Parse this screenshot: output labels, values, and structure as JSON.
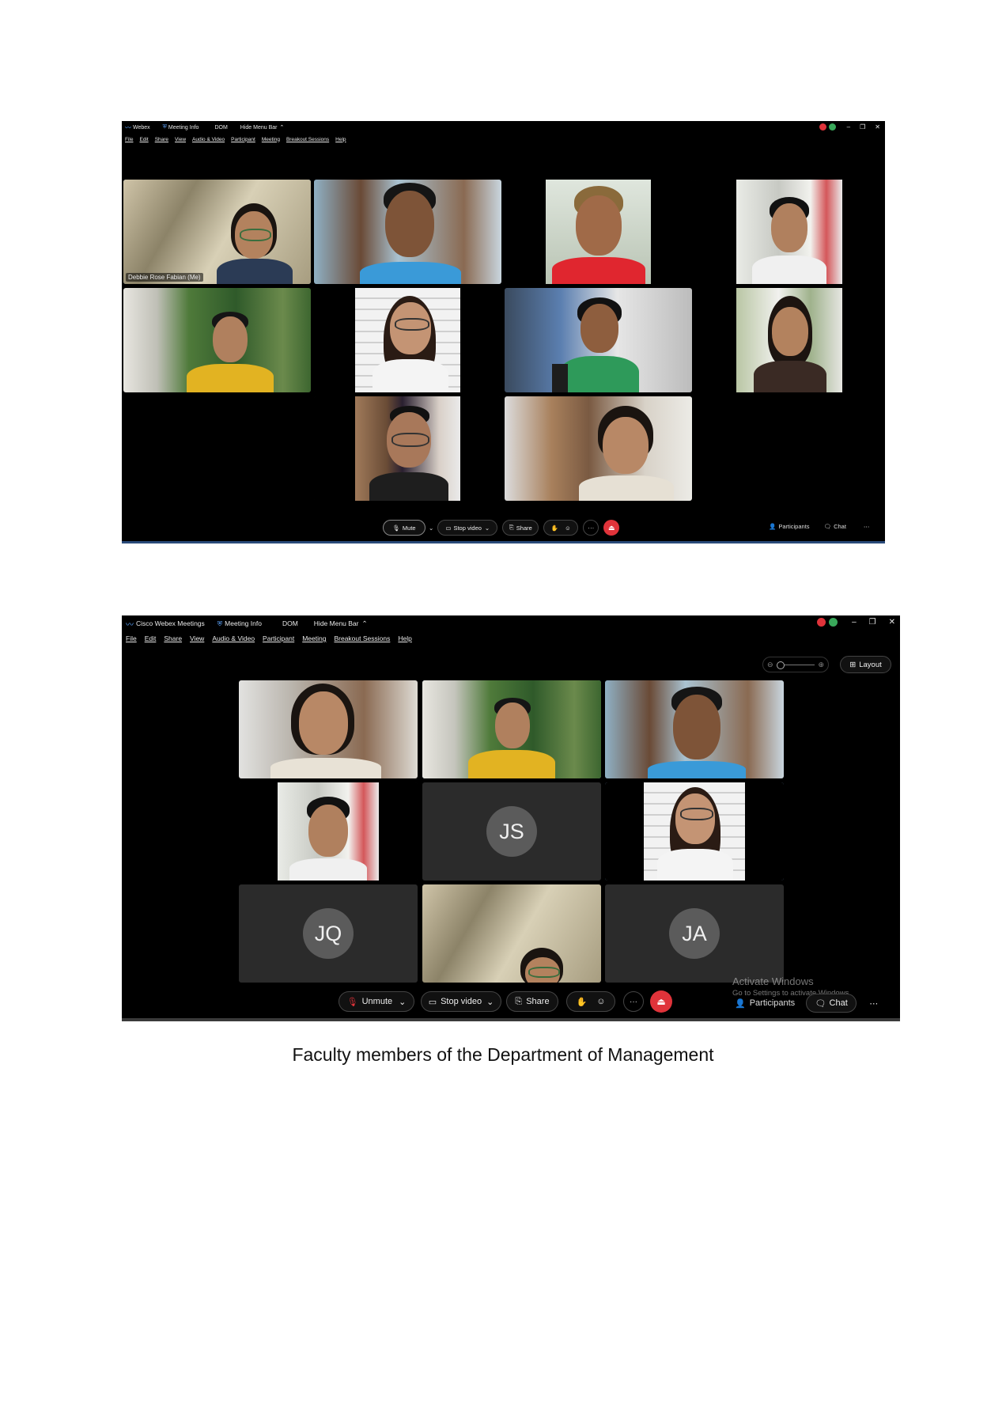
{
  "screen1": {
    "titlebar": {
      "app": "Webex",
      "meeting_info": "Meeting Info",
      "dom": "DOM",
      "hide_menu": "Hide Menu Bar"
    },
    "menu": [
      "File",
      "Edit",
      "Share",
      "View",
      "Audio & Video",
      "Participant",
      "Meeting",
      "Breakout Sessions",
      "Help"
    ],
    "self_name": "Debbie Rose Fabian (Me)",
    "controls": {
      "mute": "Mute",
      "stop_video": "Stop video",
      "share": "Share",
      "more": "···",
      "participants": "Participants",
      "chat": "Chat"
    }
  },
  "screen2": {
    "titlebar": {
      "app": "Cisco Webex Meetings",
      "meeting_info": "Meeting Info",
      "dom": "DOM",
      "hide_menu": "Hide Menu Bar"
    },
    "menu": [
      "File",
      "Edit",
      "Share",
      "View",
      "Audio & Video",
      "Participant",
      "Meeting",
      "Breakout Sessions",
      "Help"
    ],
    "layout_button": "Layout",
    "avatars": {
      "js": "JS",
      "jq": "JQ",
      "ja": "JA"
    },
    "controls": {
      "unmute": "Unmute",
      "stop_video": "Stop video",
      "share": "Share",
      "more": "···",
      "participants": "Participants",
      "chat": "Chat"
    },
    "watermark": {
      "line1": "Activate Windows",
      "line2": "Go to Settings to activate Windows."
    }
  },
  "caption": "Faculty members of the Department of Management",
  "colors": {
    "end_call": "#e0333a",
    "active_border": "#8fb8e8",
    "avatar_bg": "#5b5b5b",
    "tile_bg": "#2b2b2b"
  }
}
